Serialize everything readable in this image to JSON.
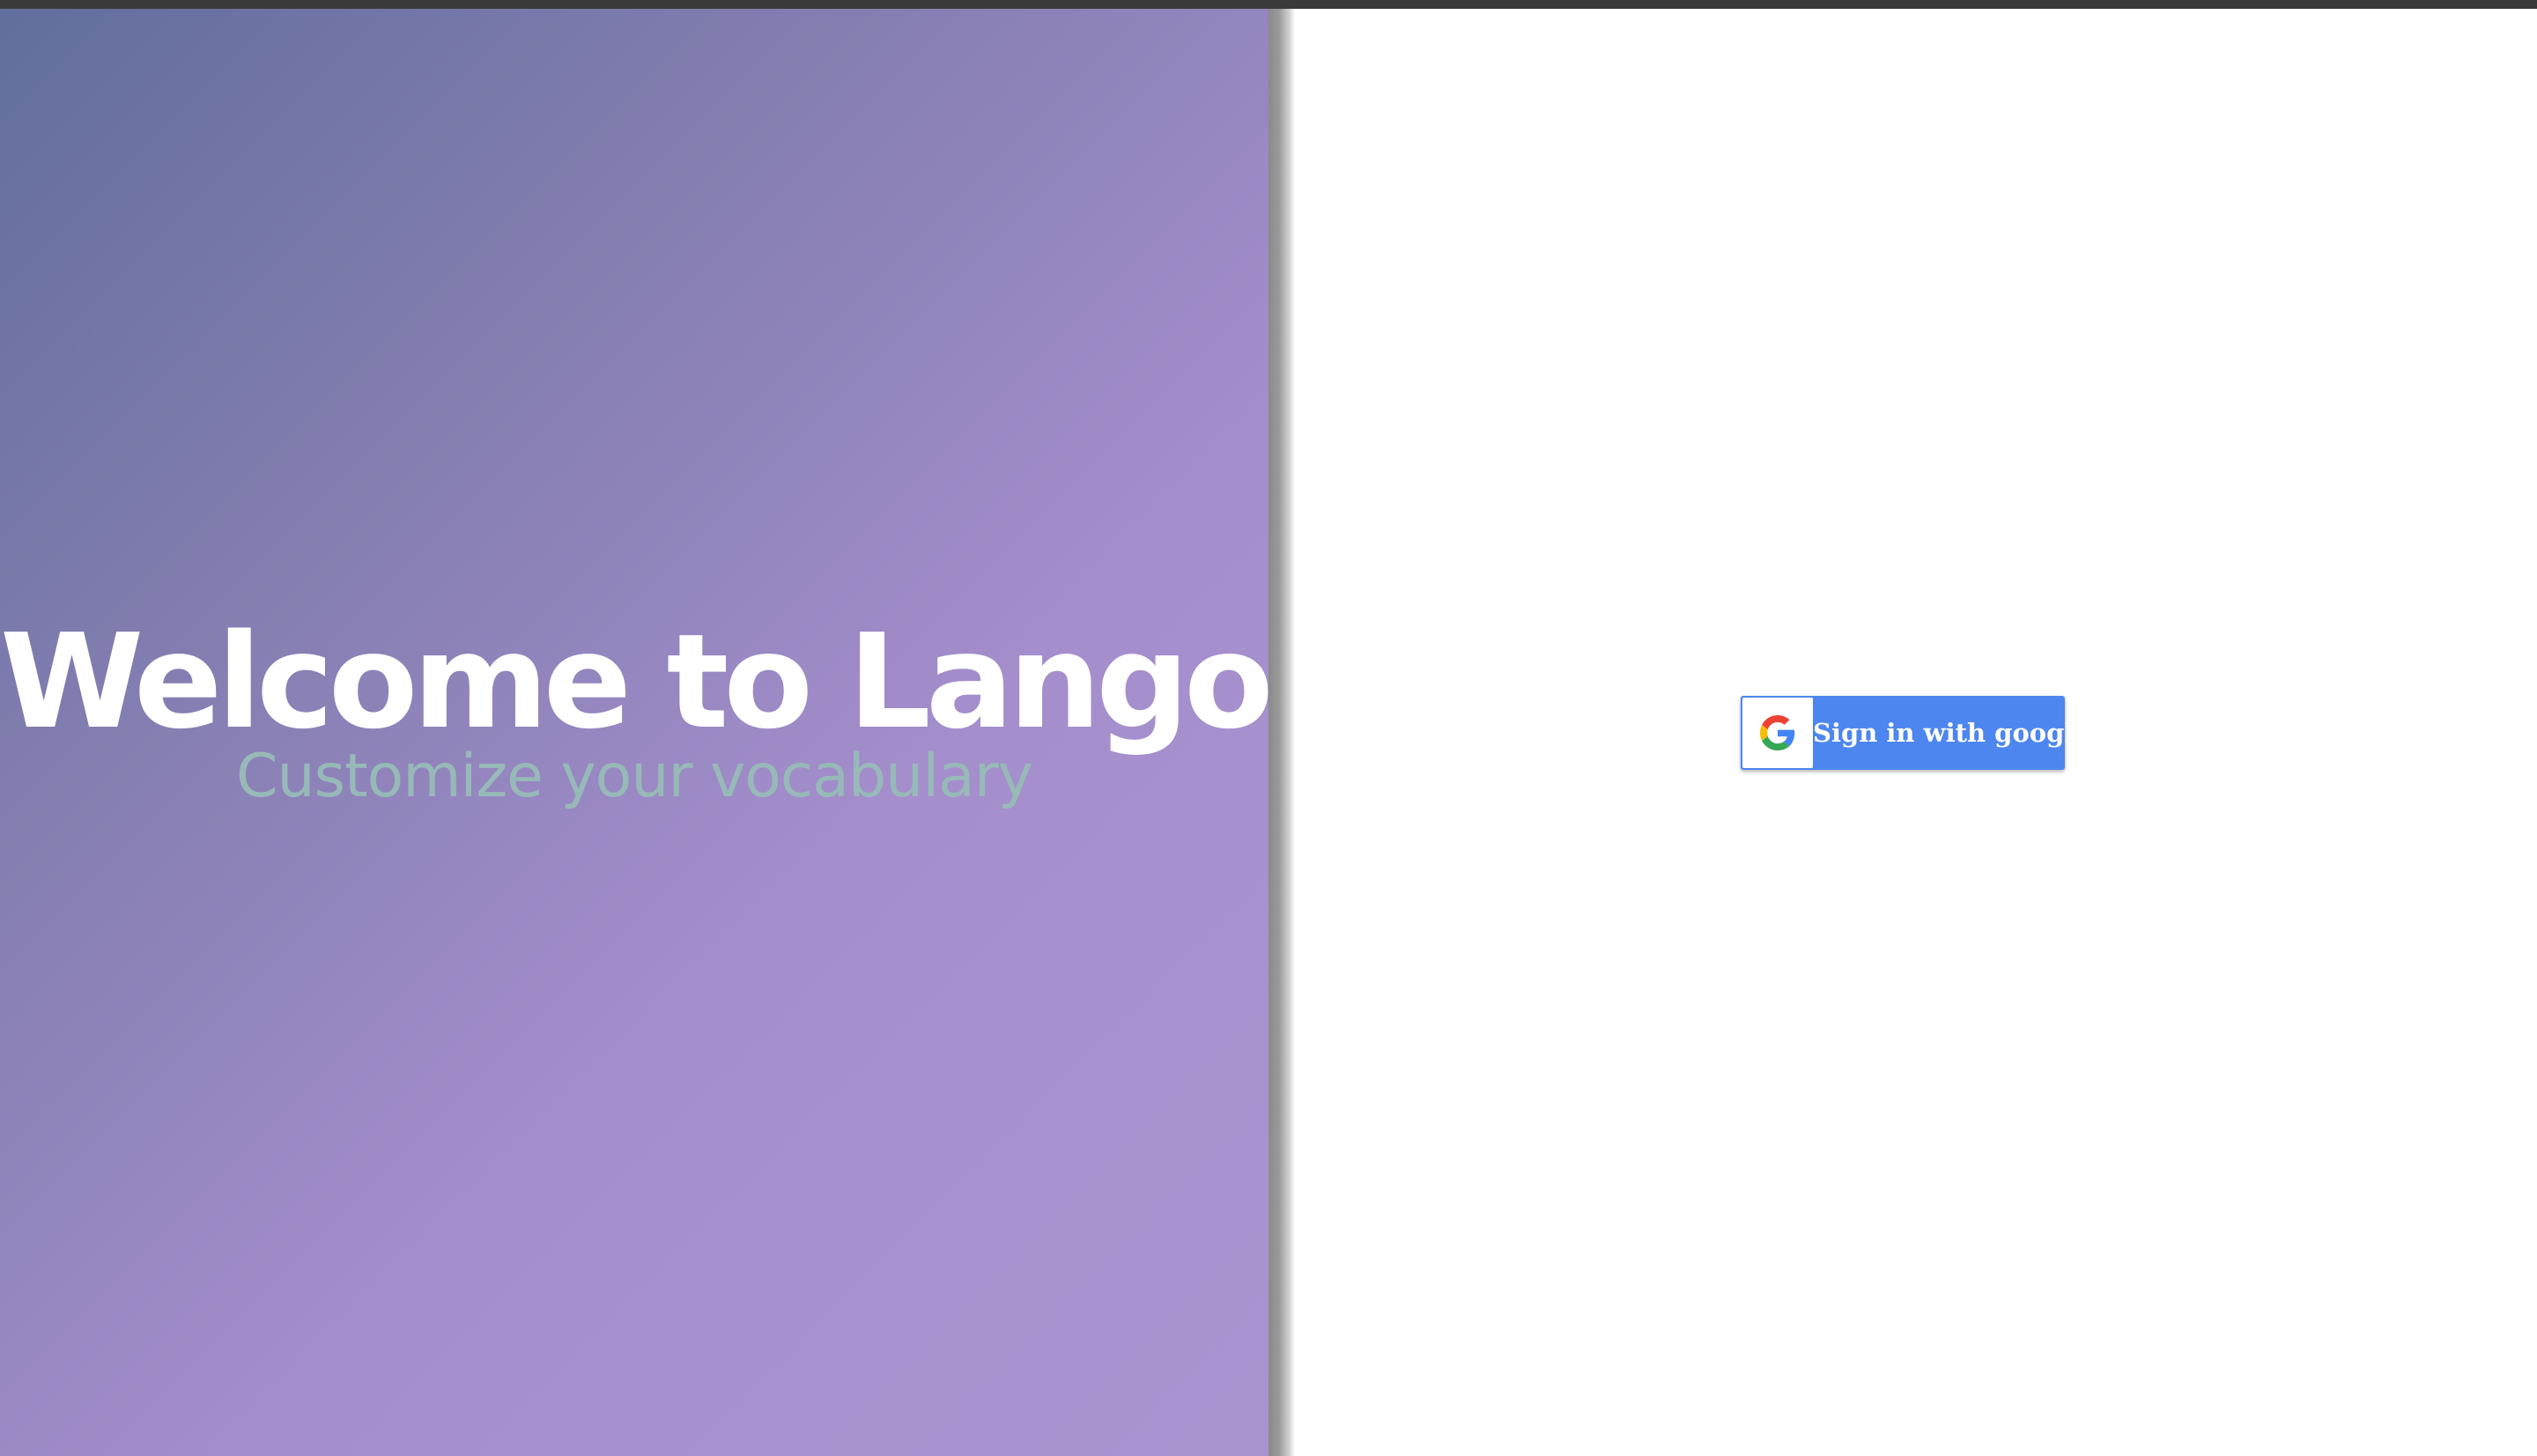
{
  "hero": {
    "title": "Welcome to Lango!",
    "subtitle": "Customize your vocabulary"
  },
  "auth": {
    "google_button_label": "Sign in with google",
    "icon": "google-logo-icon"
  },
  "colors": {
    "gradient_start": "#626e9c",
    "gradient_end": "#aa94d0",
    "subtitle": "#97b9b8",
    "google_button": "#4d86ee"
  }
}
